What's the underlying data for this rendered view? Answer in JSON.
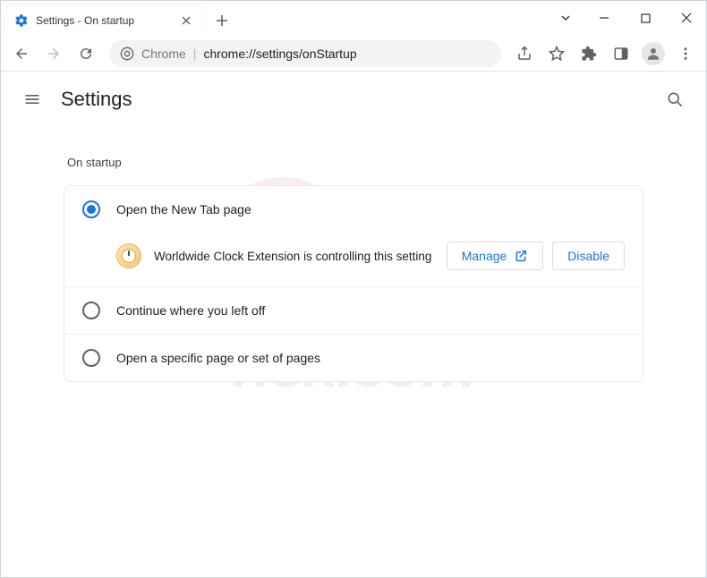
{
  "window": {
    "tab_title": "Settings - On startup",
    "minimize_tip": "Minimize",
    "maximize_tip": "Maximize",
    "close_tip": "Close"
  },
  "toolbar": {
    "url_prefix": "Chrome",
    "url_path": "chrome://settings/onStartup"
  },
  "header": {
    "title": "Settings"
  },
  "section": {
    "title": "On startup",
    "options": [
      {
        "label": "Open the New Tab page",
        "selected": true
      },
      {
        "label": "Continue where you left off",
        "selected": false
      },
      {
        "label": "Open a specific page or set of pages",
        "selected": false
      }
    ],
    "notice": {
      "text": "Worldwide Clock Extension is controlling this setting",
      "manage_label": "Manage",
      "disable_label": "Disable"
    }
  }
}
